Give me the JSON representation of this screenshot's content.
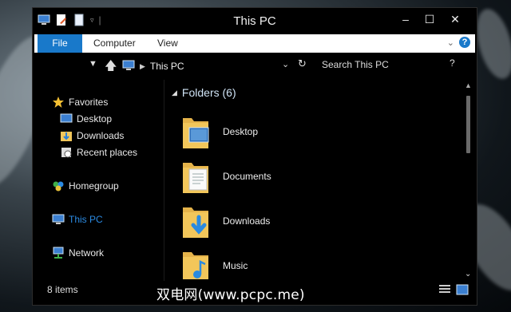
{
  "window": {
    "title": "This PC"
  },
  "ribbon": {
    "tabs": [
      "File",
      "Computer",
      "View"
    ]
  },
  "address": {
    "location": "This PC",
    "search_placeholder": "Search This PC"
  },
  "nav": {
    "favorites": "Favorites",
    "desktop": "Desktop",
    "downloads": "Downloads",
    "recent": "Recent places",
    "homegroup": "Homegroup",
    "thispc": "This PC",
    "network": "Network"
  },
  "content": {
    "group_title": "Folders (6)",
    "folders": [
      "Desktop",
      "Documents",
      "Downloads",
      "Music"
    ]
  },
  "status": {
    "items": "8 items"
  },
  "overlay": {
    "watermark": "双电网(www.pcpc.me)"
  },
  "colors": {
    "accent": "#1979ca",
    "selected_nav": "#2b8ae2",
    "folder_yellow": "#f2c65a"
  }
}
